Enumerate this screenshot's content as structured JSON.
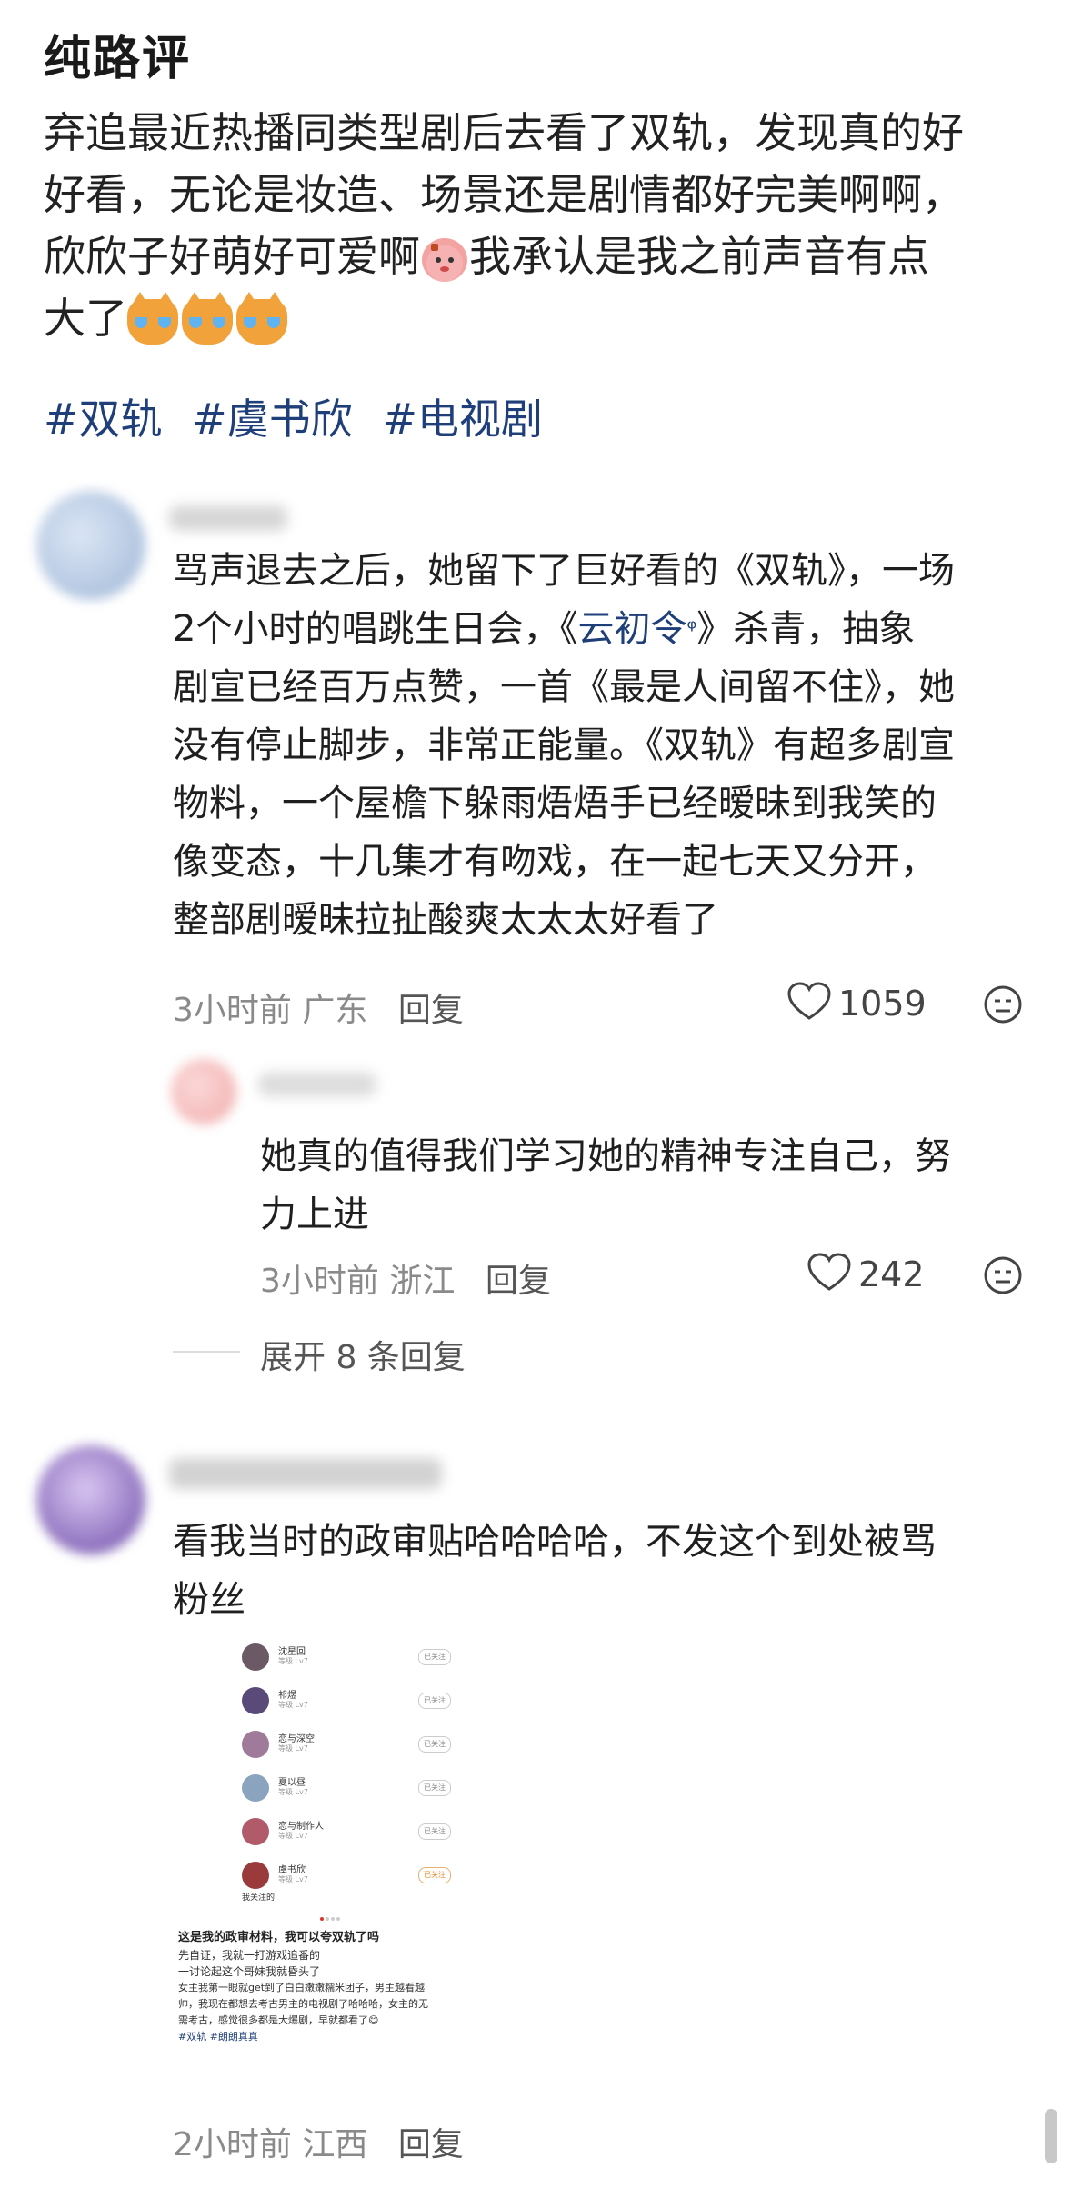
{
  "post": {
    "title": "纯路评",
    "lines": [
      "弃追最近热播同类型剧后去看了双轨，发现真的好",
      "好看，无论是妆造、场景还是剧情都好完美啊啊，",
      "欣欣子好萌好可爱啊",
      "我承认是我之前声音有点",
      "大了"
    ],
    "tags": [
      "#双轨",
      "#虞书欣",
      "#电视剧"
    ]
  },
  "comments": [
    {
      "lines": [
        "骂声退去之后，她留下了巨好看的《双轨》，一场",
        "2个小时的唱跳生日会，《",
        "云初令",
        "》杀青，抽象",
        "剧宣已经百万点赞，一首《最是人间留不住》，她",
        "没有停止脚步，非常正能量。《双轨》有超多剧宣",
        "物料，一个屋檐下躲雨焐焐手已经暧昧到我笑的",
        "像变态，十几集才有吻戏，在一起七天又分开，",
        "整部剧暧昧拉扯酸爽太太太好看了"
      ],
      "time": "3小时前",
      "location": "广东",
      "reply": "回复",
      "likes": "1059"
    },
    {
      "lines": [
        "她真的值得我们学习她的精神专注自己，努",
        "力上进"
      ],
      "time": "3小时前",
      "location": "浙江",
      "reply": "回复",
      "likes": "242"
    },
    {
      "lines": [
        "看我当时的政审贴哈哈哈哈，不发这个到处被骂",
        "粉丝"
      ],
      "time": "2小时前",
      "location": "江西",
      "reply": "回复"
    }
  ],
  "expand_replies": "展开 8 条回复",
  "screenshot": {
    "names": [
      "沈星回",
      "祁煜",
      "恋与深空",
      "夏以昼",
      "恋与制作人",
      "虞书欣"
    ],
    "subtitle": "等级 Lv7",
    "button": "已关注",
    "follow_label": "我关注的",
    "caption": "这是我的政审材料，我可以夸双轨了吗",
    "body": [
      "先自证，我就一打游戏追番的",
      "一讨论起这个哥妹我就昏头了",
      "女主我第一眼就get到了白白嫩嫩糯米团子，男主越看越",
      "帅，我现在都想去考古男主的电视剧了哈哈哈，女主的无",
      "需考古，感觉很多都是大爆剧，早就都看了😋",
      "#双轨 #朗朗真真"
    ]
  },
  "colors": {
    "link": "#1f3f7a",
    "meta": "#8a8a8a",
    "text": "#1f1f1f"
  }
}
